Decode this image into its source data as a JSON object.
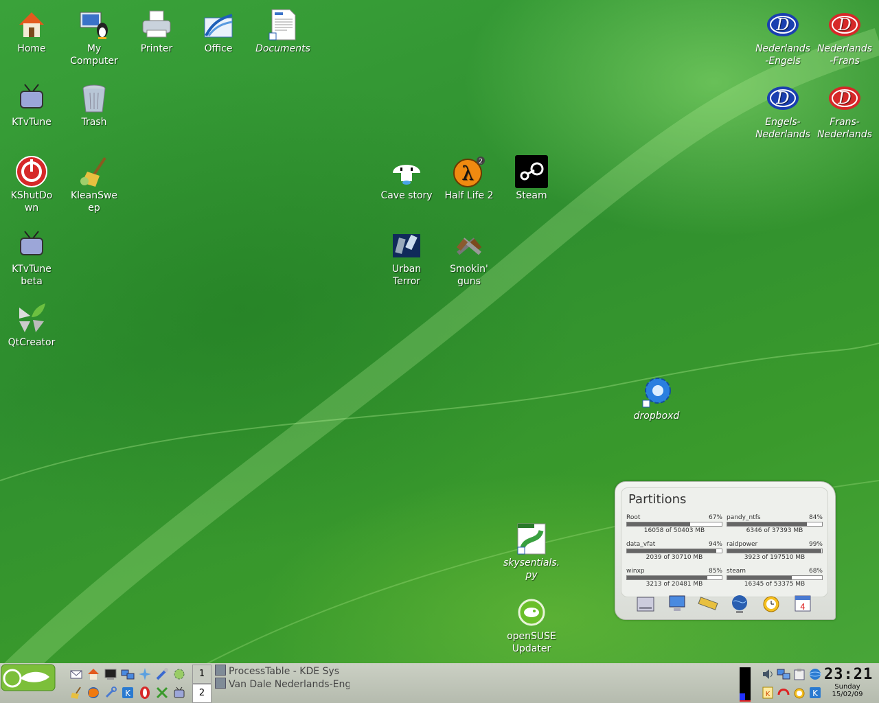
{
  "desktop_icons": {
    "home": "Home",
    "my_computer": "My\nComputer",
    "printer": "Printer",
    "office": "Office",
    "documents": "Documents",
    "ktvtune": "KTvTune",
    "trash": "Trash",
    "kshutdown": "KShutDo\nwn",
    "kleansweep": "KleanSwe\nep",
    "ktvtune_beta": "KTvTune\nbeta",
    "qtcreator": "QtCreator",
    "nl_en": "Nederlands\n-Engels",
    "nl_fr": "Nederlands\n-Frans",
    "en_nl": "Engels-\nNederlands",
    "fr_nl": "Frans-\nNederlands",
    "cave_story": "Cave story",
    "half_life_2": "Half Life 2",
    "steam": "Steam",
    "urban_terror": "Urban\nTerror",
    "smokin_guns": "Smokin'\nguns",
    "dropboxd": "dropboxd",
    "skysentials": "skysentials.\npy",
    "opensuse_updater": "openSUSE\nUpdater"
  },
  "partitions_widget": {
    "title": "Partitions",
    "items": [
      {
        "name": "Root",
        "percent": "67%",
        "fraction": 0.67,
        "size": "16058 of 50403 MB"
      },
      {
        "name": "pandy_ntfs",
        "percent": "84%",
        "fraction": 0.84,
        "size": "6346 of 37393 MB"
      },
      {
        "name": "data_vfat",
        "percent": "94%",
        "fraction": 0.94,
        "size": "2039 of 30710 MB"
      },
      {
        "name": "raidpower",
        "percent": "99%",
        "fraction": 0.99,
        "size": "3923 of 197510 MB"
      },
      {
        "name": "winxp",
        "percent": "85%",
        "fraction": 0.85,
        "size": "3213 of 20481 MB"
      },
      {
        "name": "steam",
        "percent": "68%",
        "fraction": 0.68,
        "size": "16345 of 53375 MB"
      }
    ],
    "icons": [
      "harddisk-icon",
      "monitor-icon",
      "memory-icon",
      "network-globe-icon",
      "alarm-clock-icon",
      "calendar-icon"
    ]
  },
  "taskbar": {
    "desktops": [
      "1",
      "2"
    ],
    "tasks": [
      "ProcessTable - KDE Sys",
      "Van Dale Nederlands-Engel"
    ],
    "clock_time": "23:21",
    "clock_day": "Sunday",
    "clock_date": "15/02/09"
  },
  "colors": {
    "desktop_green": "#3a9a2c",
    "taskbar": "#c0c6b8",
    "accent_red": "#d63030",
    "accent_blue": "#1a3fb0"
  }
}
